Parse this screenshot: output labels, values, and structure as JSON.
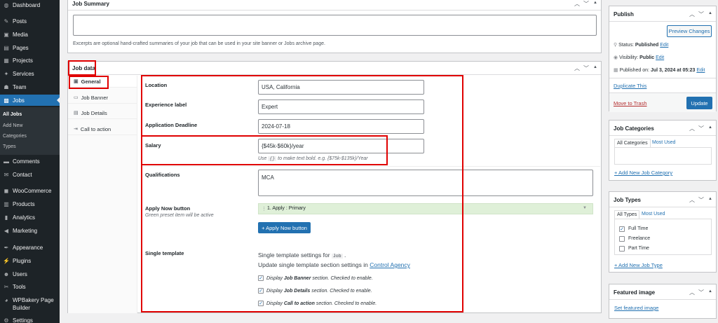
{
  "sidebar": {
    "items": [
      {
        "label": "Dashboard",
        "icon": "dashboard-icon",
        "glyph": "◍"
      },
      {
        "label": "Posts",
        "icon": "pin-icon",
        "glyph": "✎"
      },
      {
        "label": "Media",
        "icon": "media-icon",
        "glyph": "▣"
      },
      {
        "label": "Pages",
        "icon": "pages-icon",
        "glyph": "▤"
      },
      {
        "label": "Projects",
        "icon": "projects-icon",
        "glyph": "▦"
      },
      {
        "label": "Services",
        "icon": "services-icon",
        "glyph": "✦"
      },
      {
        "label": "Team",
        "icon": "team-icon",
        "glyph": "☗"
      },
      {
        "label": "Jobs",
        "icon": "jobs-icon",
        "glyph": "▩"
      },
      {
        "label": "Comments",
        "icon": "comments-icon",
        "glyph": "▬"
      },
      {
        "label": "Contact",
        "icon": "contact-icon",
        "glyph": "✉"
      },
      {
        "label": "WooCommerce",
        "icon": "woocommerce-icon",
        "glyph": "◼"
      },
      {
        "label": "Products",
        "icon": "products-icon",
        "glyph": "▥"
      },
      {
        "label": "Analytics",
        "icon": "analytics-icon",
        "glyph": "▮"
      },
      {
        "label": "Marketing",
        "icon": "marketing-icon",
        "glyph": "◀"
      },
      {
        "label": "Appearance",
        "icon": "appearance-icon",
        "glyph": "✒"
      },
      {
        "label": "Plugins",
        "icon": "plugins-icon",
        "glyph": "⚡"
      },
      {
        "label": "Users",
        "icon": "users-icon",
        "glyph": "☻"
      },
      {
        "label": "Tools",
        "icon": "tools-icon",
        "glyph": "✂"
      },
      {
        "label": "WPBakery Page",
        "icon": "wpbakery-icon",
        "glyph": "◕"
      },
      {
        "label": "Builder",
        "icon": "",
        "glyph": ""
      },
      {
        "label": "Settings",
        "icon": "settings-icon",
        "glyph": "⚙"
      }
    ],
    "submenu": [
      "All Jobs",
      "Add New",
      "Categories",
      "Types"
    ]
  },
  "job_summary": {
    "title": "Job Summary",
    "help": "Excerpts are optional hand-crafted summaries of your job that can be used in your site banner or Jobs archive page."
  },
  "job_data": {
    "title": "Job data",
    "tabs": [
      {
        "label": "General",
        "glyph": "▣"
      },
      {
        "label": "Job Banner",
        "glyph": "▭"
      },
      {
        "label": "Job Details",
        "glyph": "▤"
      },
      {
        "label": "Call to action",
        "glyph": "⇥"
      }
    ],
    "fields": {
      "location_label": "Location",
      "location_value": "USA, California",
      "experience_label": "Experience label",
      "experience_value": "Expert",
      "deadline_label": "Application Deadline",
      "deadline_value": "2024-07-18",
      "salary_label": "Salary",
      "salary_value": "{$45k-$60k}/year",
      "salary_help_pre": "Use",
      "salary_help_code": "{}",
      "salary_help_post": "to make text bold. e.g. {$75k-$135k}/Year",
      "qualifications_label": "Qualifications",
      "qualifications_value": "MCA",
      "apply_label": "Apply Now button",
      "apply_note": "Green preset item will be active",
      "apply_preset": "1. Apply : Primary",
      "apply_add_button": "+ Apply Now button",
      "single_label": "Single template",
      "single_line1_pre": "Single template settings for",
      "single_line1_code": "Job",
      "single_line2_pre": "Update single template section settings in",
      "single_line2_link": "Control Agency",
      "checks": [
        {
          "pre": "Display",
          "bold": "Job Banner",
          "post": "section. Checked to enable."
        },
        {
          "pre": "Display",
          "bold": "Job Details",
          "post": "section. Checked to enable."
        },
        {
          "pre": "Display",
          "bold": "Call to action",
          "post": "section. Checked to enable."
        }
      ]
    }
  },
  "publish": {
    "title": "Publish",
    "preview_button": "Preview Changes",
    "status_label": "Status:",
    "status_value": "Published",
    "visibility_label": "Visibility:",
    "visibility_value": "Public",
    "published_label": "Published on:",
    "published_value": "Jul 3, 2024 at 05:23",
    "edit": "Edit",
    "duplicate": "Duplicate This",
    "trash": "Move to Trash",
    "update_button": "Update"
  },
  "job_categories": {
    "title": "Job Categories",
    "tab_all": "All Categories",
    "tab_used": "Most Used",
    "add_link": "+ Add New Job Category"
  },
  "job_types": {
    "title": "Job Types",
    "tab_all": "All Types",
    "tab_used": "Most Used",
    "items": [
      {
        "label": "Full Time",
        "checked": true
      },
      {
        "label": "Freelance",
        "checked": false
      },
      {
        "label": "Part Time",
        "checked": false
      }
    ],
    "add_link": "+ Add New Job Type"
  },
  "featured_image": {
    "title": "Featured image",
    "link": "Set featured image"
  },
  "controls": {
    "up": "︿",
    "down": "﹀",
    "toggle": "▲"
  },
  "colors": {
    "accent": "#2271b1",
    "highlight": "#e00000",
    "preset_green": "#dff0d8"
  }
}
